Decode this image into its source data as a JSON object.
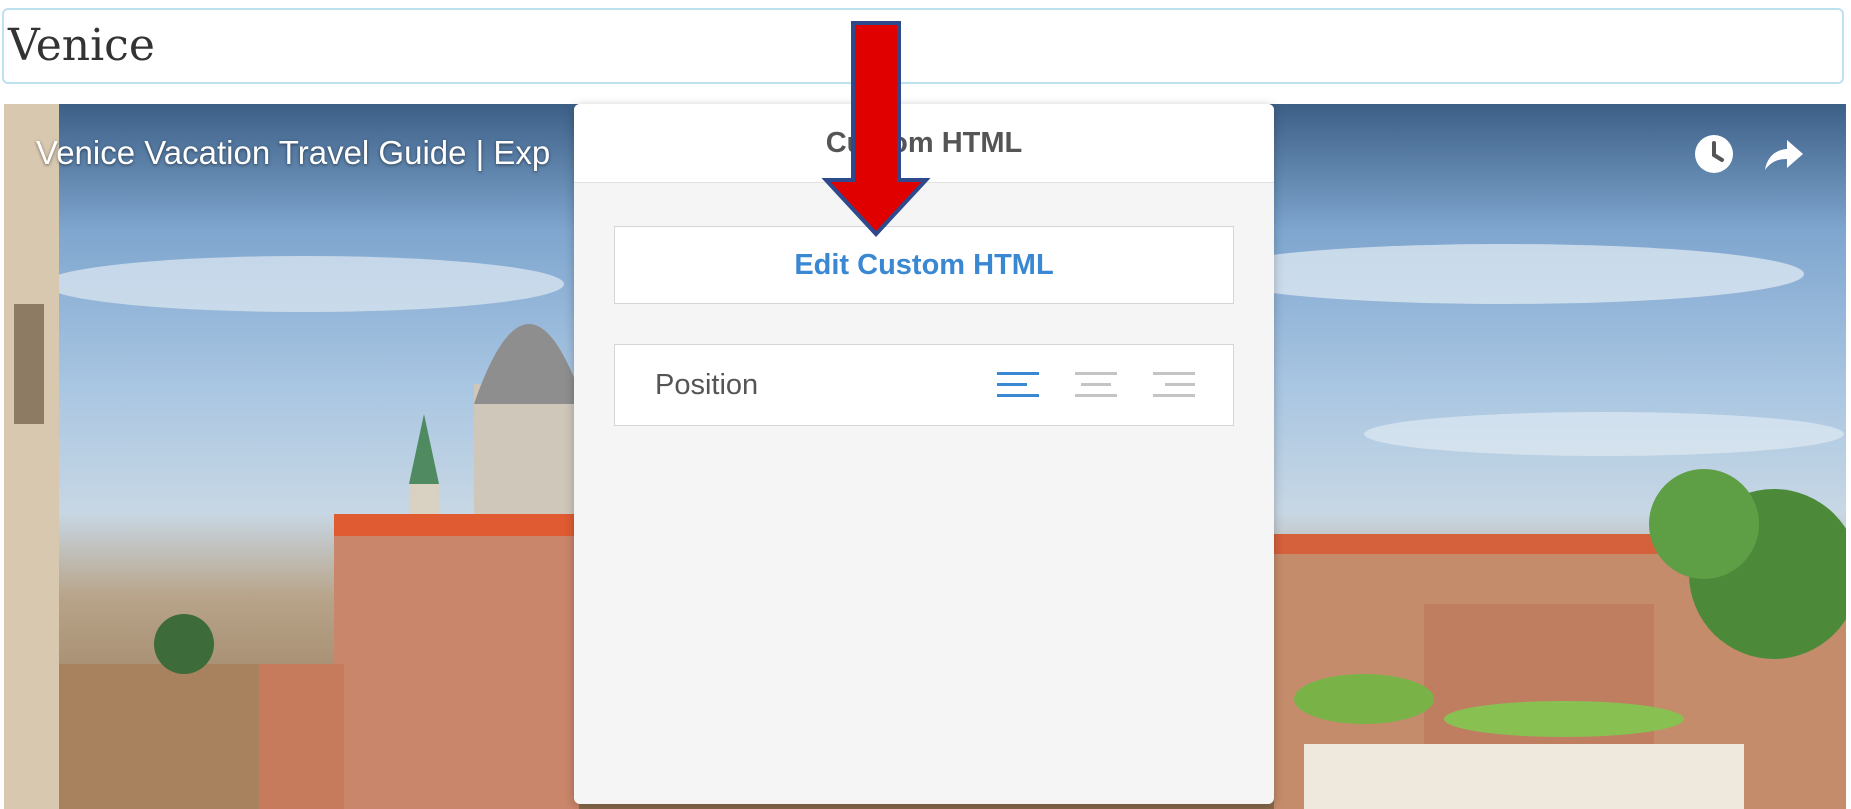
{
  "title_field": {
    "value": "Venice"
  },
  "video": {
    "title": "Venice Vacation Travel Guide | Exp",
    "icons": [
      "clock-icon",
      "share-arrow-icon"
    ]
  },
  "popover": {
    "header": "Custom HTML",
    "edit_button": "Edit Custom HTML",
    "position_label": "Position",
    "alignment_options": [
      "align-left-icon",
      "align-center-icon",
      "align-right-icon"
    ],
    "selected_alignment": "align-left-icon"
  },
  "colors": {
    "accent": "#3a87d2",
    "arrow": "#e00000",
    "arrow_outline": "#2e4a8c"
  }
}
